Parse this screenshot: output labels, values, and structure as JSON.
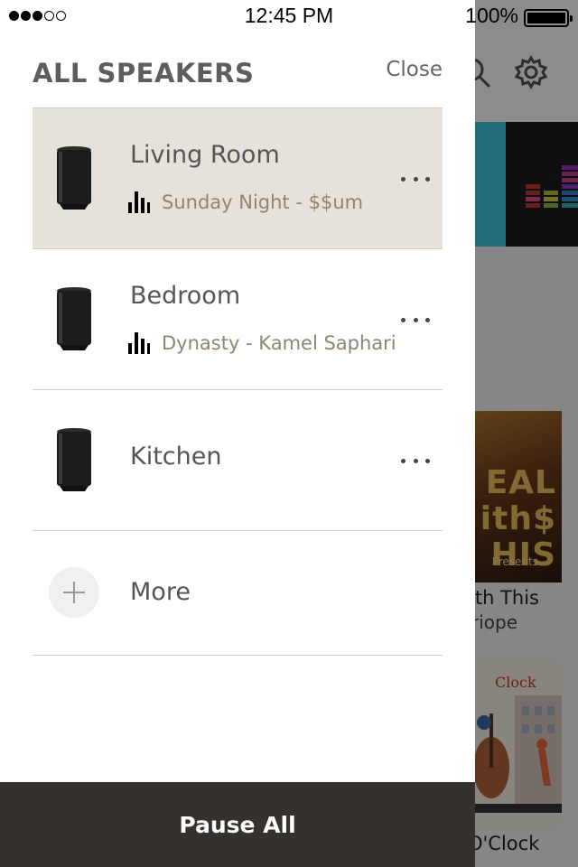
{
  "status_bar": {
    "time": "12:45 PM",
    "battery_percent": "100%",
    "signal_bars_on": 3,
    "signal_bars_total": 5
  },
  "drawer": {
    "title": "ALL SPEAKERS",
    "close_label": "Close",
    "speakers": [
      {
        "name": "Living Room",
        "now_playing": "Sunday Night - $$um",
        "active": true,
        "speaker_icon": "speaker-icon",
        "menu_icon": "more-dots-icon"
      },
      {
        "name": "Bedroom",
        "now_playing": "Dynasty - Kamel Saphari",
        "active": false,
        "speaker_icon": "speaker-icon",
        "menu_icon": "more-dots-icon"
      },
      {
        "name": "Kitchen",
        "now_playing": "",
        "active": false,
        "speaker_icon": "speaker-icon",
        "menu_icon": "more-dots-icon"
      }
    ],
    "more_label": "More",
    "more_icon": "plus-icon",
    "pause_all_label": "Pause All"
  },
  "background": {
    "icons": [
      "search-icon",
      "gear-icon"
    ],
    "album1_art_text": "EAL\nith$\nHIS",
    "album1_art_presents": "Presents",
    "album1_title": "ith This",
    "album1_subtitle": "riope",
    "album2_art_text": "Clock",
    "album2_title": "O'Clock"
  },
  "colors": {
    "active_row_bg": "#e6e2da",
    "track_text": "#8f8573",
    "pause_bar_bg": "#35312d",
    "tile_cyan": "#3ec6e0"
  }
}
